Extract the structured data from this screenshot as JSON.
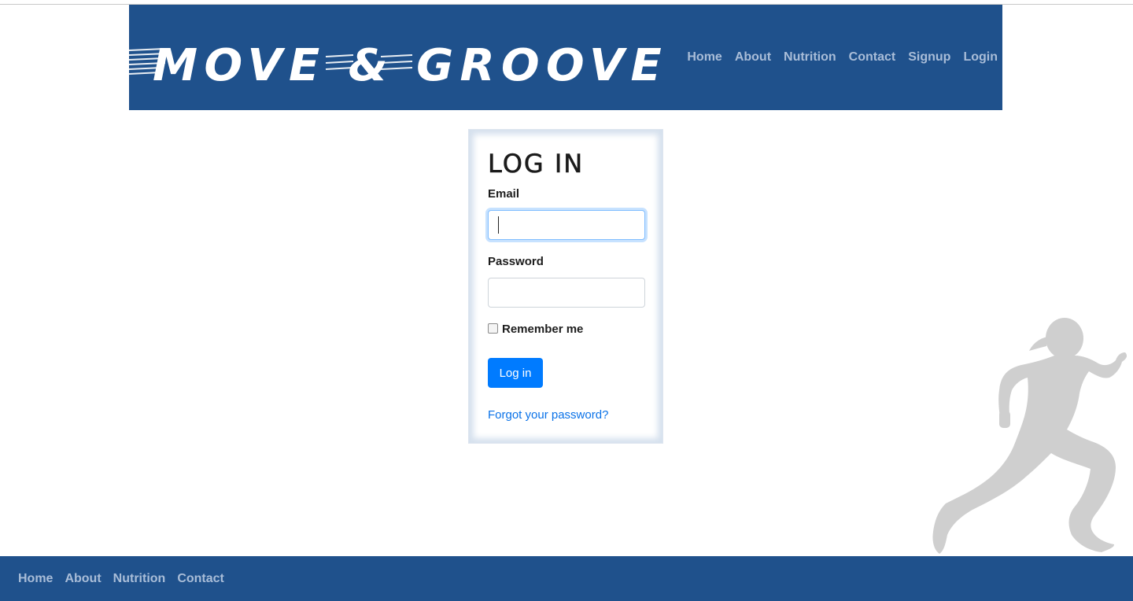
{
  "brand": {
    "logo_text": "MOVE & GROOVE",
    "color_header": "#1f518c",
    "color_link": "#a9bdd8",
    "color_primary": "#007bff"
  },
  "header": {
    "nav": [
      "Home",
      "About",
      "Nutrition",
      "Contact",
      "Signup",
      "Login"
    ]
  },
  "login": {
    "title": "LOG IN",
    "email_label": "Email",
    "email_value": "",
    "password_label": "Password",
    "password_value": "",
    "remember_label": "Remember me",
    "remember_checked": false,
    "submit_label": "Log in",
    "forgot_link": "Forgot your password?"
  },
  "footer": {
    "nav": [
      "Home",
      "About",
      "Nutrition",
      "Contact"
    ]
  }
}
